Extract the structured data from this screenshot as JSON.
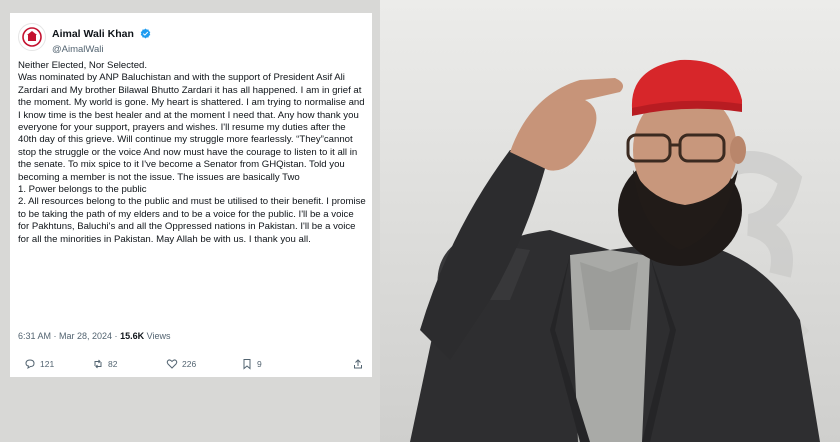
{
  "tweet": {
    "author": {
      "name": "Aimal Wali Khan",
      "handle": "@AimalWali"
    },
    "body": [
      "Neither Elected, Nor Selected.",
      "Was nominated by ANP Baluchistan and with the support of President Asif Ali Zardari and My brother Bilawal Bhutto Zardari it has all happened. I am in grief at the moment. My world is gone. My heart is shattered. I am trying to normalise and I know time is the best healer and at the moment I need that. Any how thank you everyone for your support, prayers and wishes. I'll resume my duties after the 40th day of this grieve. Will continue my struggle more fearlessly. “They”cannot stop the struggle or the voice And now must have the courage to listen to it all in the senate. To mix spice to it I've become a Senator from GHQistan. Told you becoming a member is not the issue. The issues are basically Two",
      "1. Power belongs to the public",
      "2. All resources belong to the public and must be utilised to their benefit. I promise to be taking the path of my elders and to be a voice for the public. I'll be a voice for Pakhtuns, Baluchi's and all the Oppressed nations in Pakistan. I'll be a voice for all the minorities in Pakistan. May Allah be with us. I thank you all."
    ],
    "timestamp": "6:31 AM · Mar 28, 2024 ·",
    "views_count": "15.6K",
    "views_label": "Views",
    "actions": {
      "replies": "121",
      "reposts": "82",
      "likes": "226",
      "bookmarks": "9"
    }
  },
  "colors": {
    "verified": "#1d9bf0",
    "logo_red": "#c4122f",
    "cap_red": "#d7262a"
  },
  "icons": [
    "verified-badge-icon",
    "party-logo-icon",
    "more-icon",
    "reply-icon",
    "repost-icon",
    "like-icon",
    "bookmark-icon",
    "share-icon"
  ]
}
